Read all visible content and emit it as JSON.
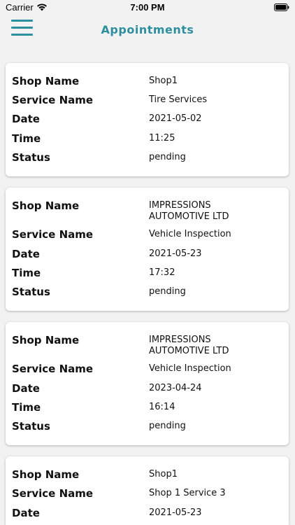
{
  "status_bar": {
    "carrier": "Carrier",
    "time": "7:00 PM",
    "icons": [
      "wifi-icon",
      "battery-icon"
    ]
  },
  "nav": {
    "title": "Appointments",
    "menu_icon": "hamburger-menu-icon",
    "accent_color": "#2d8f9e"
  },
  "labels": {
    "shop": "Shop Name",
    "service": "Service Name",
    "date": "Date",
    "time": "Time",
    "status": "Status"
  },
  "appointments": [
    {
      "shop": "Shop1",
      "service": "Tire Services",
      "date": "2021-05-02",
      "time": "11:25",
      "status": "pending"
    },
    {
      "shop": "IMPRESSIONS AUTOMOTIVE LTD",
      "service": "Vehicle Inspection",
      "date": "2021-05-23",
      "time": "17:32",
      "status": "pending"
    },
    {
      "shop": "IMPRESSIONS AUTOMOTIVE LTD",
      "service": "Vehicle Inspection",
      "date": "2023-04-24",
      "time": "16:14",
      "status": "pending"
    },
    {
      "shop": "Shop1",
      "service": "Shop 1 Service 3",
      "date": "2021-05-23"
    }
  ]
}
